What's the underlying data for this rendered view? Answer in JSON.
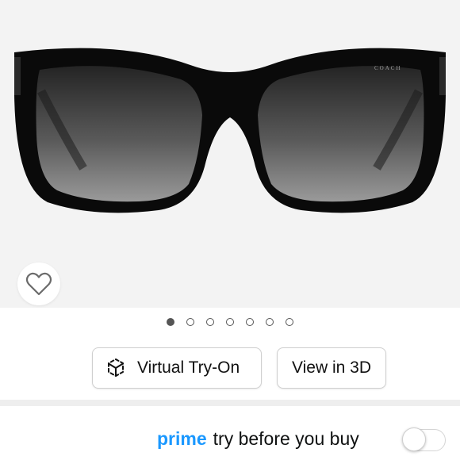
{
  "product_image": {
    "subject": "black cat-eye sunglasses with gradient grey lenses",
    "temple_logo": "COACH"
  },
  "wishlist": {
    "icon": "heart-outline-icon"
  },
  "carousel": {
    "total": 7,
    "active_index": 0
  },
  "buttons": {
    "virtual_try_on": {
      "icon": "ar-cube-icon",
      "label": "Virtual Try-On"
    },
    "view_3d": {
      "label": "View in 3D"
    }
  },
  "prime_banner": {
    "prime_word": "prime",
    "tagline": "try before you buy",
    "toggle_on": false
  },
  "colors": {
    "prime_blue": "#1a98ff",
    "text_dark": "#0f1111",
    "hero_background": "#f3f3f3"
  }
}
